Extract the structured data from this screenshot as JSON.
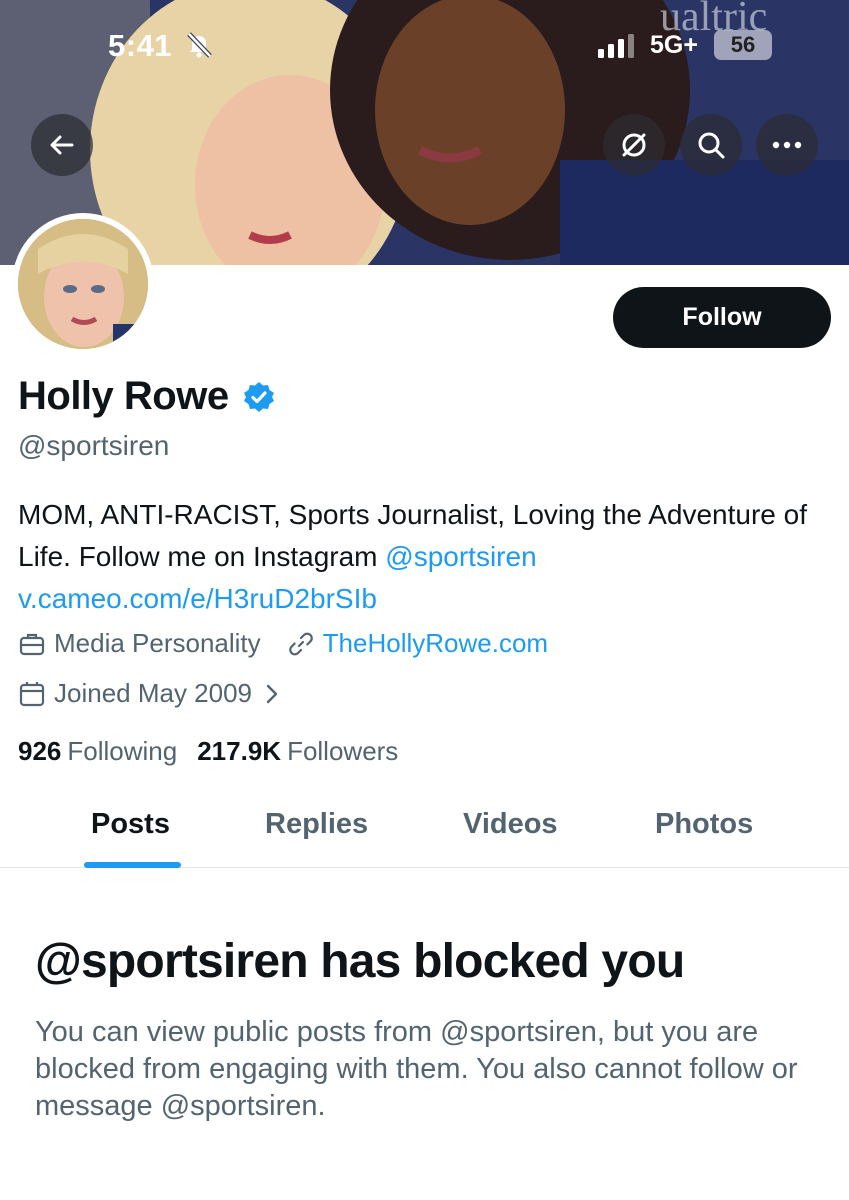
{
  "status_bar": {
    "time": "5:41",
    "network": "5G+",
    "battery": "56"
  },
  "header": {
    "icons": [
      "back-arrow-icon",
      "grok-icon",
      "search-icon",
      "more-icon"
    ]
  },
  "profile": {
    "display_name": "Holly Rowe",
    "verified": true,
    "handle": "@sportsiren",
    "follow_label": "Follow",
    "bio_text": "MOM, ANTI-RACIST, Sports Journalist, Loving the Adventure of Life. Follow me on Instagram ",
    "bio_mention": "@sportsiren",
    "bio_link": "v.cameo.com/e/H3ruD2brSIb",
    "category": "Media Personality",
    "website": "TheHollyRowe.com",
    "joined": "Joined May 2009",
    "following_count": "926",
    "following_label": "Following",
    "followers_count": "217.9K",
    "followers_label": "Followers"
  },
  "tabs": [
    {
      "label": "Posts",
      "active": true
    },
    {
      "label": "Replies",
      "active": false
    },
    {
      "label": "Videos",
      "active": false
    },
    {
      "label": "Photos",
      "active": false
    }
  ],
  "blocked": {
    "title": "@sportsiren has blocked you",
    "body": "You can view public posts from @sportsiren, but you are blocked from engaging with them. You also cannot follow or message @sportsiren."
  },
  "colors": {
    "accent": "#1d9bf0",
    "text": "#0f1419",
    "secondary": "#536471"
  }
}
